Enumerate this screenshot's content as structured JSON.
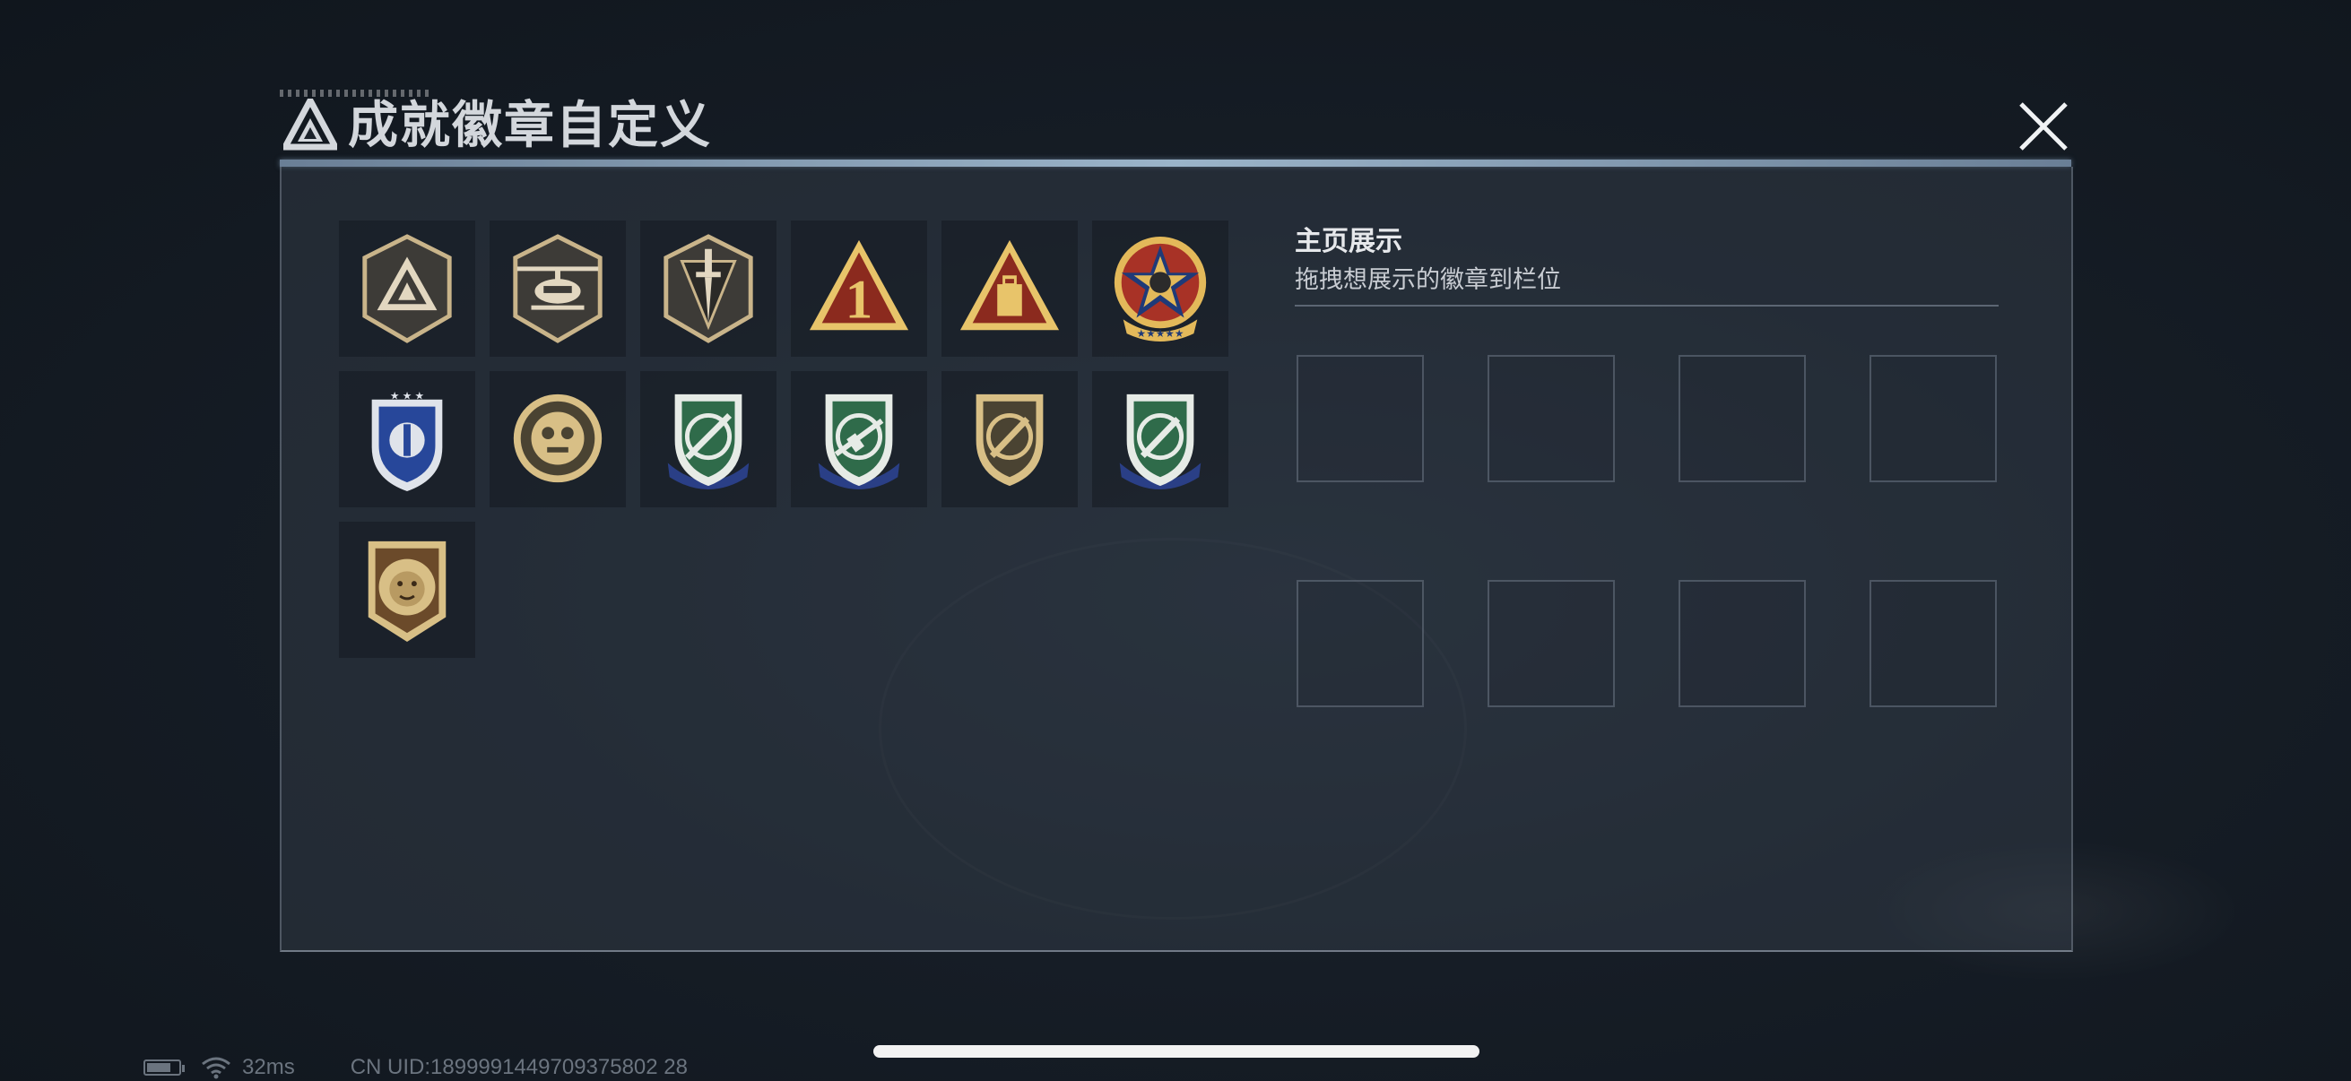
{
  "header": {
    "title": "成就徽章自定义",
    "logo_icon": "triangle-emblem-icon",
    "close_icon": "close-icon"
  },
  "badges": [
    {
      "name": "shield-triangle-badge",
      "colors": [
        "#c9b48a",
        "#3b3a36"
      ]
    },
    {
      "name": "helicopter-badge",
      "colors": [
        "#c9b48a",
        "#3b3a36"
      ]
    },
    {
      "name": "dagger-badge",
      "colors": [
        "#c9b48a",
        "#3b3a36"
      ]
    },
    {
      "name": "rank-one-triangle-badge",
      "colors": [
        "#e8c46a",
        "#8b2a1e"
      ]
    },
    {
      "name": "supply-triangle-badge",
      "colors": [
        "#e8c46a",
        "#8b2a1e"
      ]
    },
    {
      "name": "star-skull-badge",
      "colors": [
        "#e3b95a",
        "#a83226",
        "#1f3a78"
      ]
    },
    {
      "name": "blue-crest-badge",
      "colors": [
        "#dfe3ea",
        "#27479a"
      ]
    },
    {
      "name": "mask-medallion-badge",
      "colors": [
        "#d8bf86",
        "#4a4332"
      ]
    },
    {
      "name": "green-sniper-badge",
      "colors": [
        "#e6ebe6",
        "#2f6b4a",
        "#2a3f86"
      ]
    },
    {
      "name": "green-rifle-badge",
      "colors": [
        "#e6ebe6",
        "#2f6b4a",
        "#2a3f86"
      ]
    },
    {
      "name": "gold-knife-badge",
      "colors": [
        "#d8bf86",
        "#4a4332"
      ]
    },
    {
      "name": "green-knife-badge",
      "colors": [
        "#e6ebe6",
        "#2f6b4a",
        "#2a3f86"
      ]
    },
    {
      "name": "lion-badge",
      "colors": [
        "#d8bf86",
        "#6b4a2a"
      ]
    }
  ],
  "showcase": {
    "title": "主页展示",
    "subtitle": "拖拽想展示的徽章到栏位",
    "slot_count": 8
  },
  "status_bar": {
    "ping": "32ms",
    "uid": "CN UID:1899991449709375802 28"
  }
}
